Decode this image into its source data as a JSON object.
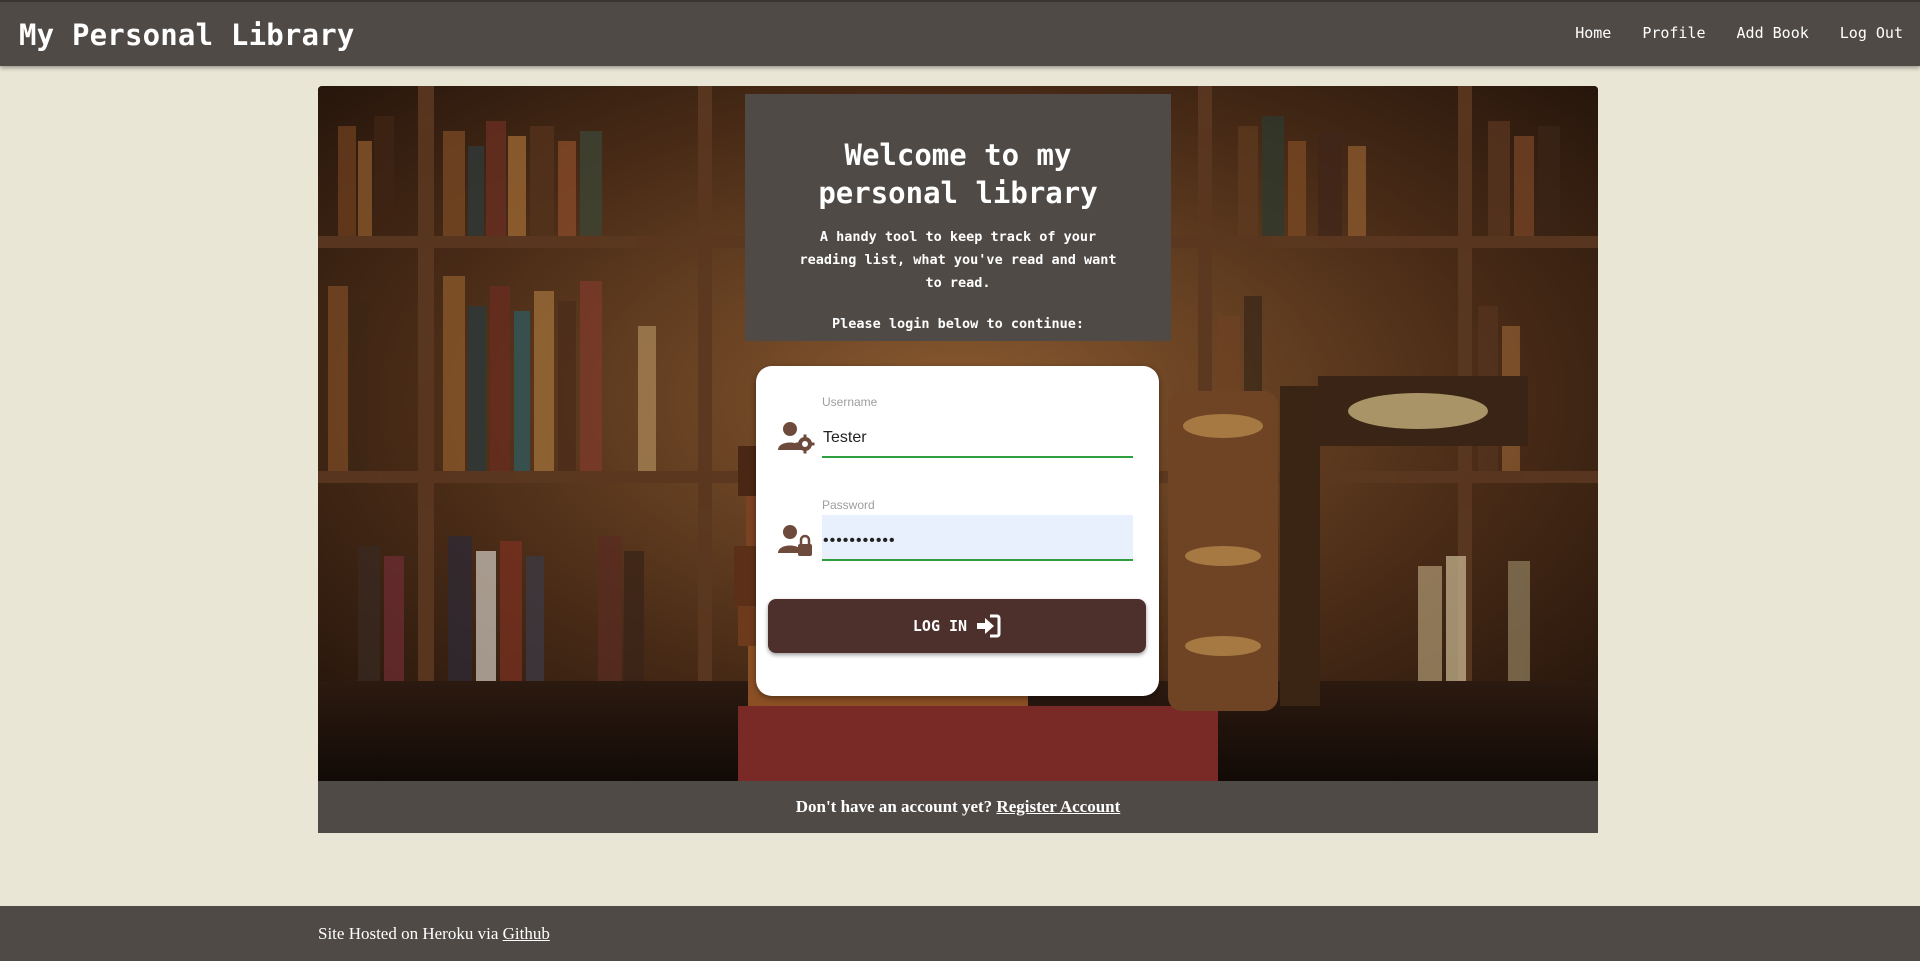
{
  "navbar": {
    "brand": "My Personal Library",
    "links": [
      "Home",
      "Profile",
      "Add Book",
      "Log Out"
    ]
  },
  "welcome": {
    "title": "Welcome to my personal library",
    "description": "A handy tool to keep track of your reading list, what you've read and want to read.",
    "prompt": "Please login below to continue:"
  },
  "login": {
    "username_label": "Username",
    "username_value": "Tester",
    "password_label": "Password",
    "password_value": "•••••••••••",
    "button_label": "LOG IN",
    "username_icon": "user-gear-icon",
    "password_icon": "user-lock-icon",
    "button_icon": "sign-in-icon"
  },
  "register": {
    "text": "Don't have an account yet?",
    "link": "Register Account"
  },
  "footer": {
    "text": "Site Hosted on Heroku via",
    "link": "Github"
  },
  "colors": {
    "background": "#eae6d6",
    "nav": "#4f4a46",
    "button": "#4d302c",
    "input_underline": "#2e9e3e"
  }
}
